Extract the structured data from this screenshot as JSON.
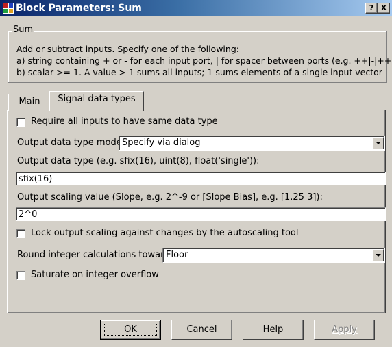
{
  "window": {
    "title": "Block Parameters: Sum",
    "help_button": "?",
    "close_button": "X"
  },
  "description": {
    "group_title": "Sum",
    "lines": [
      "Add or subtract inputs.  Specify one of the following:",
      "a) string containing + or - for each input port, | for spacer between ports (e.g. ++|-|++)",
      "b) scalar >= 1. A value > 1 sums all inputs; 1 sums elements of a single input vector"
    ]
  },
  "tabs": [
    {
      "label": "Main",
      "active": false
    },
    {
      "label": "Signal data types",
      "active": true
    }
  ],
  "signal_data_types": {
    "require_same_type": {
      "label": "Require all inputs to have same data type",
      "checked": false
    },
    "output_mode": {
      "label": "Output data type mode:",
      "value": "Specify via dialog"
    },
    "output_type": {
      "label": "Output data type (e.g. sfix(16), uint(8), float('single')):",
      "value": "sfix(16)"
    },
    "output_scaling": {
      "label": "Output scaling value (Slope, e.g. 2^-9 or [Slope Bias], e.g. [1.25 3]):",
      "value": "2^0"
    },
    "lock_scaling": {
      "label": "Lock output scaling against changes by the autoscaling tool",
      "checked": false
    },
    "round_toward": {
      "label": "Round integer calculations toward:",
      "value": "Floor"
    },
    "saturate": {
      "label": "Saturate on integer overflow",
      "checked": false
    }
  },
  "buttons": {
    "ok": "OK",
    "cancel": "Cancel",
    "help": "Help",
    "apply": "Apply"
  },
  "colors": {
    "title_gradient_start": "#0a246a",
    "title_gradient_end": "#a6caf0",
    "face": "#d4d0c8"
  }
}
